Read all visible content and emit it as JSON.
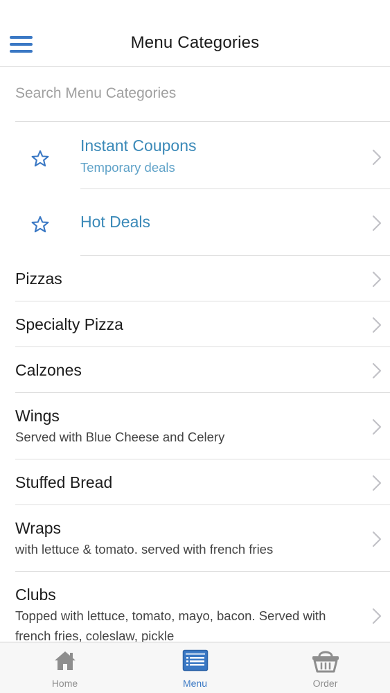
{
  "header": {
    "title": "Menu Categories"
  },
  "search": {
    "placeholder": "Search Menu Categories"
  },
  "featured": [
    {
      "title": "Instant Coupons",
      "subtitle": "Temporary deals"
    },
    {
      "title": "Hot Deals",
      "subtitle": ""
    }
  ],
  "categories": [
    {
      "title": "Pizzas",
      "subtitle": ""
    },
    {
      "title": "Specialty Pizza",
      "subtitle": ""
    },
    {
      "title": "Calzones",
      "subtitle": ""
    },
    {
      "title": "Wings",
      "subtitle": "Served with Blue Cheese and Celery"
    },
    {
      "title": "Stuffed Bread",
      "subtitle": ""
    },
    {
      "title": "Wraps",
      "subtitle": "with lettuce & tomato. served with french fries"
    },
    {
      "title": "Clubs",
      "subtitle": "Topped with lettuce, tomato, mayo, bacon. Served with french fries, coleslaw, pickle"
    }
  ],
  "tabs": [
    {
      "label": "Home",
      "icon": "home-icon",
      "active": false
    },
    {
      "label": "Menu",
      "icon": "menu-list-icon",
      "active": true
    },
    {
      "label": "Order",
      "icon": "basket-icon",
      "active": false
    }
  ],
  "colors": {
    "accent": "#3a78c4",
    "featured_text": "#3a89b8",
    "tab_inactive": "#8e8e8e"
  }
}
